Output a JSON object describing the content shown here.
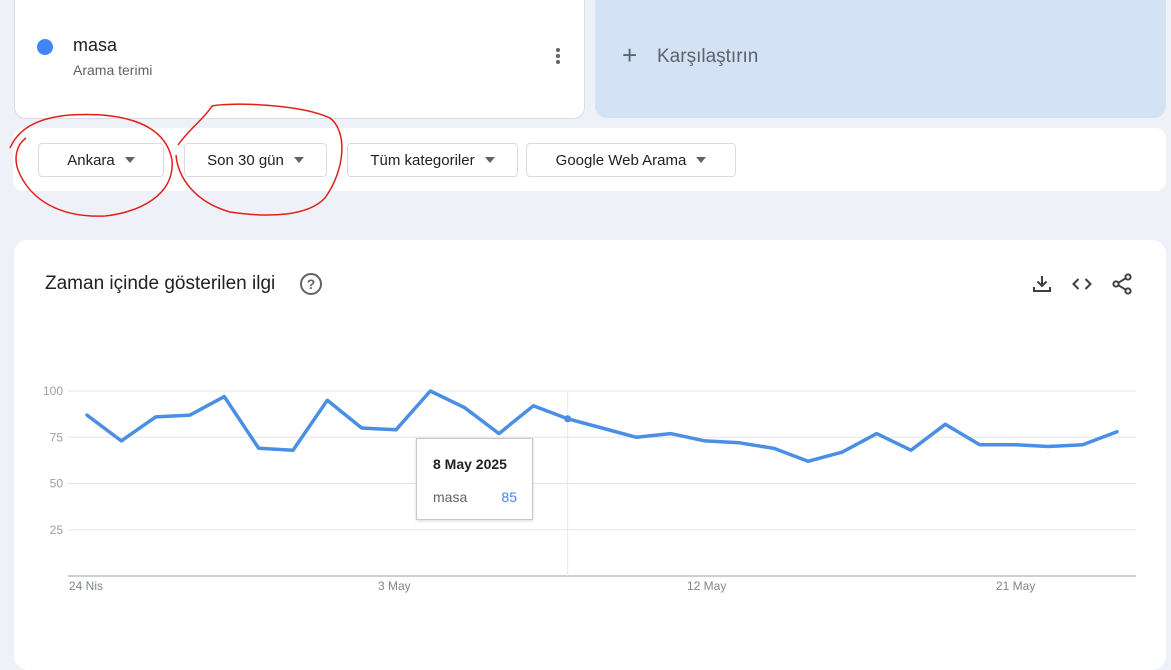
{
  "search_term": {
    "name": "masa",
    "subtitle": "Arama terimi",
    "color": "#4285f4"
  },
  "compare": {
    "label": "Karşılaştırın"
  },
  "filters": [
    {
      "label": "Ankara"
    },
    {
      "label": "Son 30 gün"
    },
    {
      "label": "Tüm kategoriler"
    },
    {
      "label": "Google Web Arama"
    }
  ],
  "chart_card": {
    "title": "Zaman içinde gösterilen ilgi"
  },
  "icons": [
    "more-vert-icon",
    "plus-icon",
    "caret-down-icon",
    "help-icon",
    "download-icon",
    "embed-icon",
    "share-icon"
  ],
  "tooltip": {
    "date": "8 May 2025",
    "term": "masa",
    "value": "85"
  },
  "chart_data": {
    "type": "line",
    "title": "",
    "ylim": [
      0,
      100
    ],
    "y_ticks": [
      100,
      75,
      50,
      25
    ],
    "x_ticks": [
      {
        "label": "24 Nis",
        "index": 0
      },
      {
        "label": "3 May",
        "index": 9
      },
      {
        "label": "12 May",
        "index": 18
      },
      {
        "label": "21 May",
        "index": 27
      }
    ],
    "categories": [
      "24 Nis",
      "25 Nis",
      "26 Nis",
      "27 Nis",
      "28 Nis",
      "29 Nis",
      "30 Nis",
      "1 May",
      "2 May",
      "3 May",
      "4 May",
      "5 May",
      "6 May",
      "7 May",
      "8 May",
      "9 May",
      "10 May",
      "11 May",
      "12 May",
      "13 May",
      "14 May",
      "15 May",
      "16 May",
      "17 May",
      "18 May",
      "19 May",
      "20 May",
      "21 May",
      "22 May",
      "23 May",
      "24 May"
    ],
    "series": [
      {
        "name": "masa",
        "color": "#4a8fe3",
        "values": [
          87,
          73,
          86,
          87,
          97,
          69,
          68,
          95,
          80,
          79,
          100,
          91,
          77,
          92,
          85,
          80,
          75,
          77,
          73,
          72,
          69,
          62,
          67,
          77,
          68,
          82,
          71,
          71,
          70,
          71,
          78
        ]
      }
    ],
    "highlight_index": 14,
    "grid": true
  }
}
